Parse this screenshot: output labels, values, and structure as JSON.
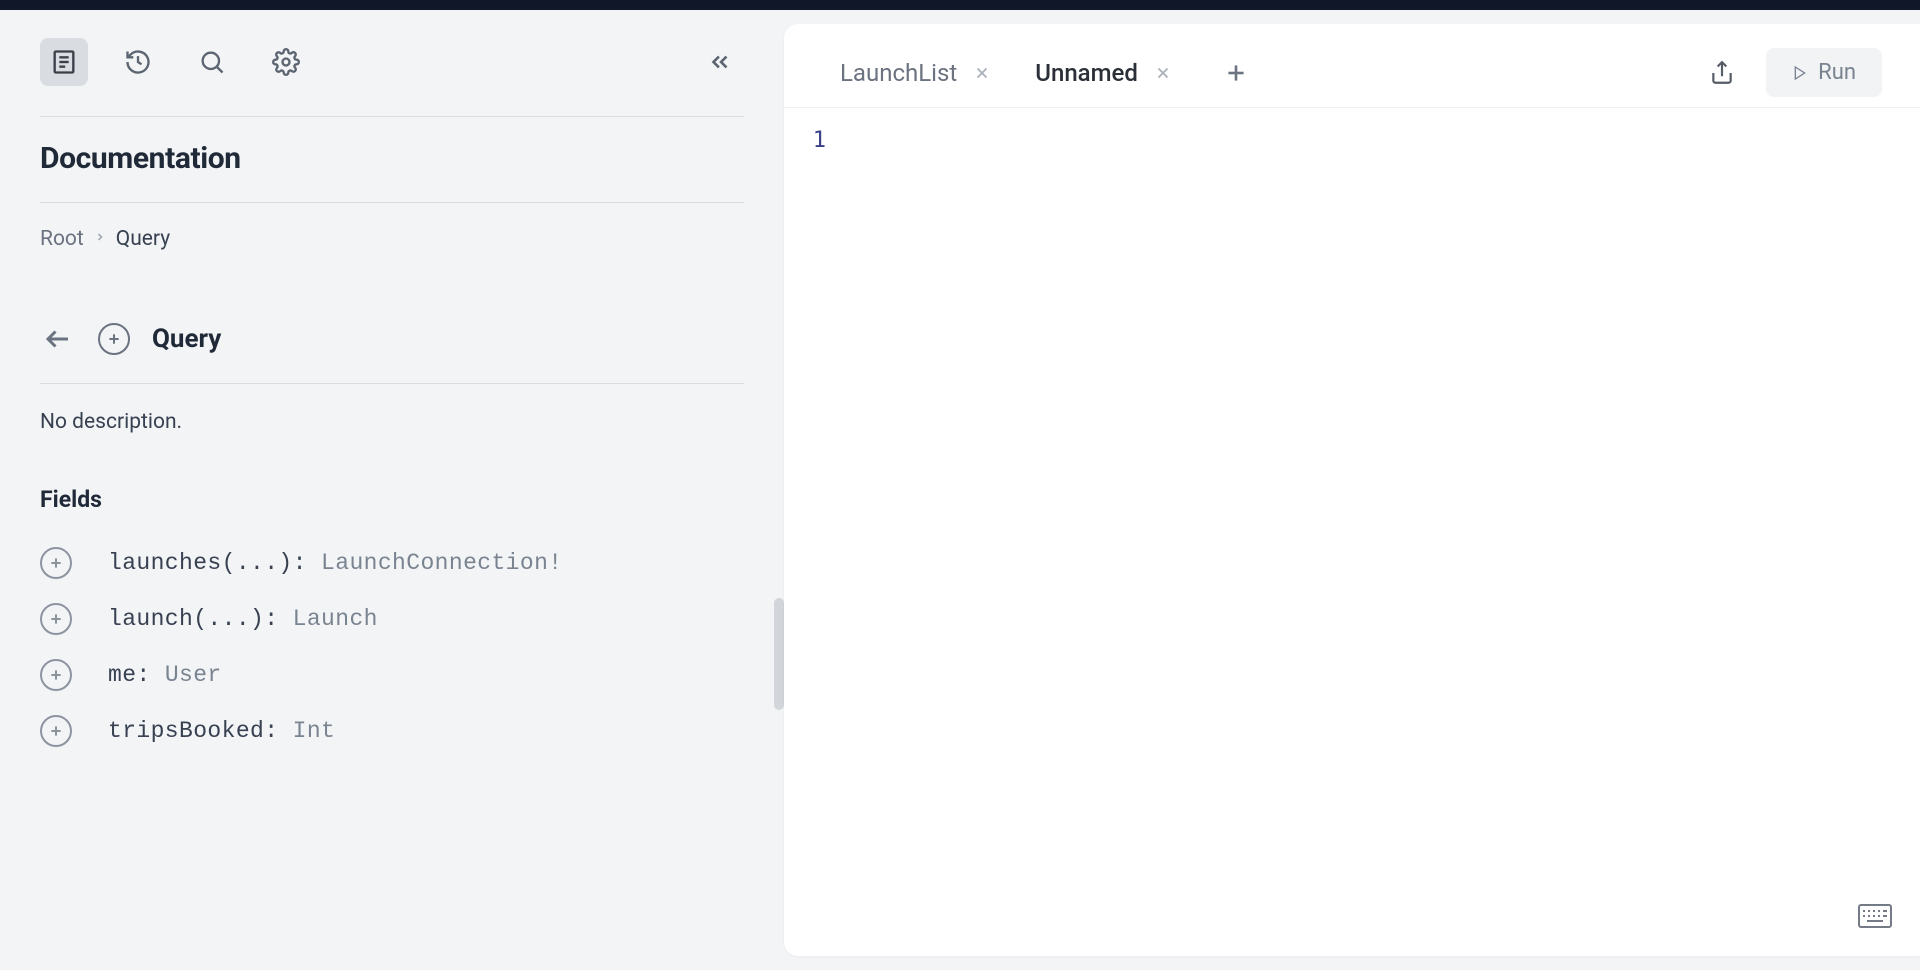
{
  "sidebar": {
    "title": "Documentation",
    "breadcrumb": {
      "root": "Root",
      "current": "Query"
    },
    "type": {
      "name": "Query",
      "description": "No description."
    },
    "fields_heading": "Fields",
    "fields": [
      {
        "name": "launches",
        "args": "(...)",
        "type": "LaunchConnection!"
      },
      {
        "name": "launch",
        "args": "(...)",
        "type": "Launch"
      },
      {
        "name": "me",
        "args": "",
        "type": "User"
      },
      {
        "name": "tripsBooked",
        "args": "",
        "type": "Int"
      }
    ]
  },
  "tabs": [
    {
      "label": "LaunchList",
      "active": false
    },
    {
      "label": "Unnamed",
      "active": true
    }
  ],
  "actions": {
    "run_label": "Run"
  },
  "editor": {
    "line_numbers": [
      "1"
    ]
  }
}
